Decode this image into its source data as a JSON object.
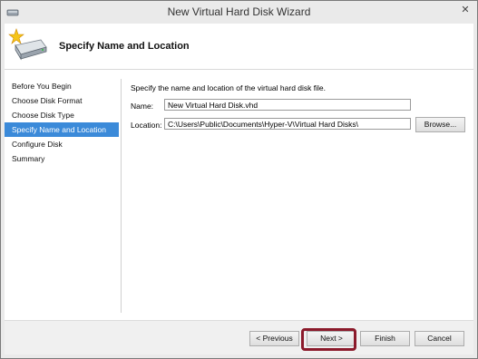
{
  "window": {
    "title": "New Virtual Hard Disk Wizard",
    "close_glyph": "✕"
  },
  "header": {
    "heading": "Specify Name and Location",
    "icon": "disk-star-icon"
  },
  "steps": [
    "Before You Begin",
    "Choose Disk Format",
    "Choose Disk Type",
    "Specify Name and Location",
    "Configure Disk",
    "Summary"
  ],
  "active_step": 3,
  "form": {
    "instruction": "Specify the name and location of the virtual hard disk file.",
    "name_label": "Name:",
    "name_value": "New Virtual Hard Disk.vhd",
    "location_label": "Location:",
    "location_value": "C:\\Users\\Public\\Documents\\Hyper-V\\Virtual Hard Disks\\",
    "browse_label": "Browse..."
  },
  "buttons": {
    "previous": "< Previous",
    "next": "Next >",
    "finish": "Finish",
    "cancel": "Cancel"
  },
  "colors": {
    "highlight": "#8b1a2b",
    "active_step": "#3b8ad9"
  }
}
